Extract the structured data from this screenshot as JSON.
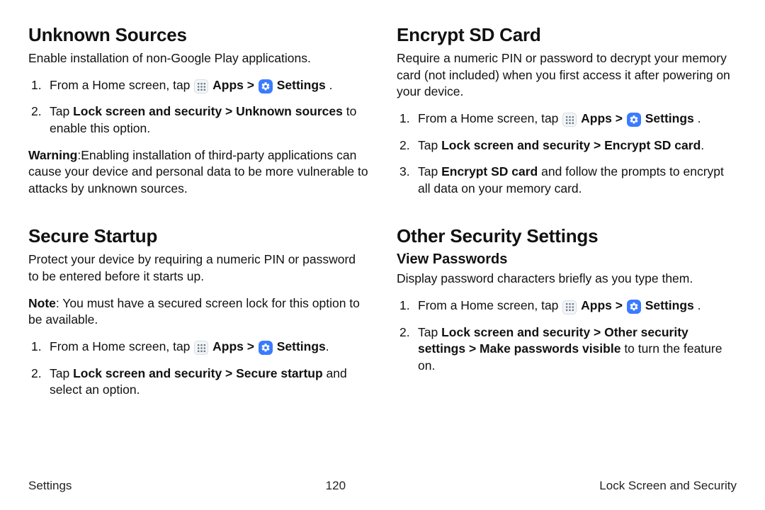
{
  "left": {
    "unknown_sources": {
      "heading": "Unknown Sources",
      "intro": "Enable installation of non-Google Play applications.",
      "step1_prefix": "From a Home screen, tap ",
      "apps_label": "Apps",
      "settings_label": "Settings",
      "step2_bold": "Lock screen and security > Unknown sources",
      "step2_tail": " to enable this option.",
      "warning_label": "Warning",
      "warning_body": ":Enabling installation of third-party applications can cause your device and personal data to be more vulnerable to attacks by unknown sources."
    },
    "secure_startup": {
      "heading": "Secure Startup",
      "intro": "Protect your device by requiring a numeric PIN or password to be entered before it starts up.",
      "note_label": "Note",
      "note_body": ": You must have a secured screen lock for this option to be available.",
      "step1_prefix": "From a Home screen, tap ",
      "apps_label": "Apps",
      "settings_label": "Settings",
      "step2_bold": "Lock screen and security > Secure startup",
      "step2_tail": " and select an option."
    }
  },
  "right": {
    "encrypt_sd": {
      "heading": "Encrypt SD Card",
      "intro": "Require a numeric PIN or password to decrypt your memory card (not included) when you first access it after powering on your device.",
      "step1_prefix": "From a Home screen, tap ",
      "apps_label": "Apps",
      "settings_label": "Settings",
      "step2_bold": "Lock screen and security > Encrypt SD card",
      "step3_prefix": "Tap ",
      "step3_bold": "Encrypt SD card",
      "step3_tail": " and follow the prompts to encrypt all data on your memory card."
    },
    "other_security": {
      "heading": "Other Security Settings",
      "view_passwords": {
        "subheading": "View Passwords",
        "intro": "Display password characters briefly as you type them.",
        "step1_prefix": "From a Home screen, tap ",
        "apps_label": "Apps",
        "settings_label": "Settings",
        "step2_bold": "Lock screen and security > Other security settings > Make passwords visible",
        "step2_tail": " to turn the feature on."
      }
    }
  },
  "footer": {
    "left": "Settings",
    "center": "120",
    "right": "Lock Screen and Security"
  },
  "common": {
    "tap": "Tap ",
    "sep": " > ",
    "period": " .",
    "period_tight": "."
  }
}
